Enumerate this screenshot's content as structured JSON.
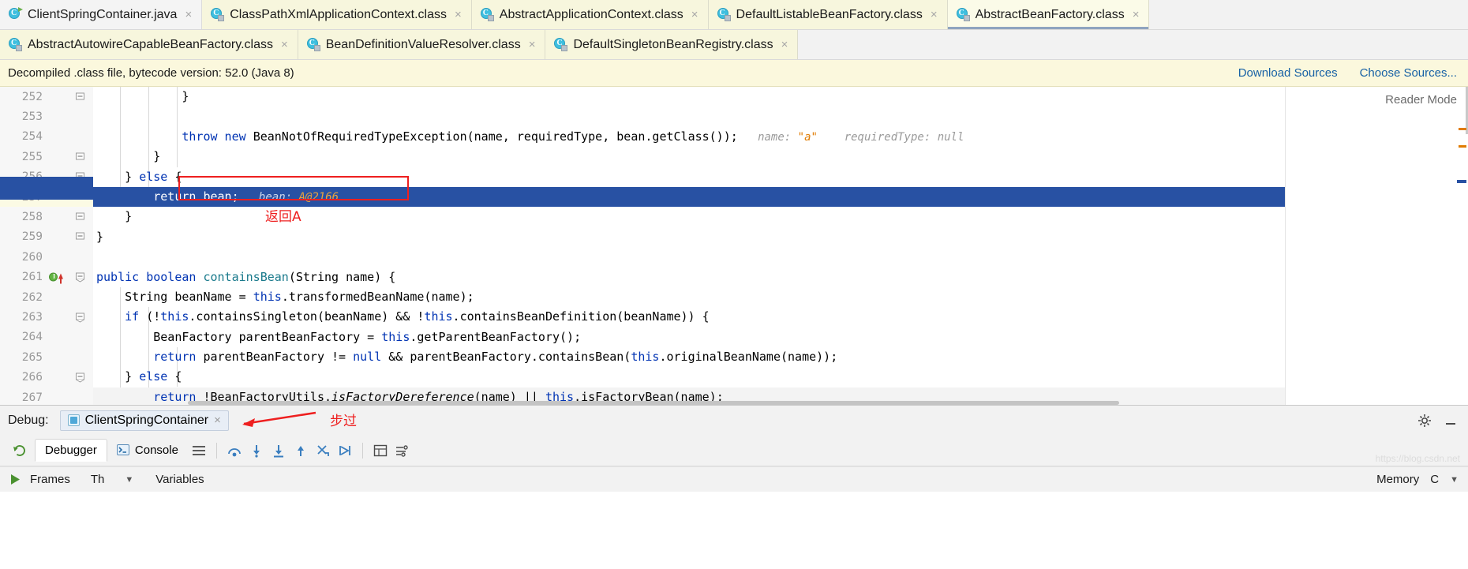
{
  "tabs_row1": [
    {
      "label": "ClientSpringContainer.java",
      "icon": "java-class-run-icon",
      "state": "inactive-white",
      "close": "×"
    },
    {
      "label": "ClassPathXmlApplicationContext.class",
      "icon": "class-file-icon",
      "state": "inactive",
      "close": "×"
    },
    {
      "label": "AbstractApplicationContext.class",
      "icon": "class-file-icon",
      "state": "inactive",
      "close": "×"
    },
    {
      "label": "DefaultListableBeanFactory.class",
      "icon": "class-file-icon",
      "state": "inactive",
      "close": "×"
    },
    {
      "label": "AbstractBeanFactory.class",
      "icon": "class-file-icon",
      "state": "selected",
      "close": "×"
    }
  ],
  "tabs_row2": [
    {
      "label": "AbstractAutowireCapableBeanFactory.class",
      "icon": "class-file-icon",
      "state": "inactive",
      "close": "×"
    },
    {
      "label": "BeanDefinitionValueResolver.class",
      "icon": "class-file-icon",
      "state": "inactive",
      "close": "×"
    },
    {
      "label": "DefaultSingletonBeanRegistry.class",
      "icon": "class-file-icon",
      "state": "inactive",
      "close": "×"
    }
  ],
  "notification": {
    "message": "Decompiled .class file, bytecode version: 52.0 (Java 8)",
    "download_sources": "Download Sources",
    "choose_sources": "Choose Sources...",
    "bg_color": "#fbf8dd"
  },
  "editor": {
    "reader_mode": "Reader Mode",
    "selection_color": "#2851a3",
    "annotation_color": "#ee1f1f",
    "lines": [
      {
        "num": "252",
        "fold": "minus",
        "text": "            }",
        "hint": "",
        "selected": false
      },
      {
        "num": "253",
        "fold": "",
        "text": "",
        "hint": "",
        "selected": false
      },
      {
        "num": "254",
        "fold": "",
        "text": "            throw new BeanNotOfRequiredTypeException(name, requiredType, bean.getClass());",
        "hint": "name: \"a\"     requiredType: null",
        "selected": false
      },
      {
        "num": "255",
        "fold": "minus",
        "text": "        }",
        "hint": "",
        "selected": false
      },
      {
        "num": "256",
        "fold": "minus",
        "text": "    } else {",
        "hint": "",
        "selected": false
      },
      {
        "num": "257",
        "fold": "",
        "text": "        return bean;",
        "hint": "bean: A@2166",
        "selected": true
      },
      {
        "num": "258",
        "fold": "minus",
        "text": "    }",
        "hint": "",
        "selected": false
      },
      {
        "num": "259",
        "fold": "minus",
        "text": "}",
        "hint": "",
        "selected": false
      },
      {
        "num": "260",
        "fold": "",
        "text": "",
        "hint": "",
        "selected": false
      },
      {
        "num": "261",
        "fold": "plus",
        "breakpoint": true,
        "text": "public boolean containsBean(String name) {",
        "hint": "",
        "selected": false
      },
      {
        "num": "262",
        "fold": "",
        "text": "    String beanName = this.transformedBeanName(name);",
        "hint": "",
        "selected": false
      },
      {
        "num": "263",
        "fold": "plus",
        "text": "    if (!this.containsSingleton(beanName) && !this.containsBeanDefinition(beanName)) {",
        "hint": "",
        "selected": false
      },
      {
        "num": "264",
        "fold": "",
        "text": "        BeanFactory parentBeanFactory = this.getParentBeanFactory();",
        "hint": "",
        "selected": false
      },
      {
        "num": "265",
        "fold": "",
        "text": "        return parentBeanFactory != null && parentBeanFactory.containsBean(this.originalBeanName(name));",
        "hint": "",
        "selected": false
      },
      {
        "num": "266",
        "fold": "minus",
        "text": "    } else {",
        "hint": "",
        "selected": false
      },
      {
        "num": "267",
        "fold": "",
        "text": "        return !BeanFactoryUtils.isFactoryDereference(name) || this.isFactoryBean(name);",
        "hint": "",
        "selected": false
      }
    ],
    "annotation_cn": "返回A"
  },
  "debug": {
    "label": "Debug:",
    "session_tab": "ClientSpringContainer",
    "session_close": "×",
    "step_annotation": "步过",
    "settings_icon": "gear-icon",
    "minimize_icon": "minimize-icon",
    "tabs": [
      {
        "label": "Debugger",
        "icon": "",
        "active": true
      },
      {
        "label": "Console",
        "icon": "console-icon",
        "active": false
      }
    ],
    "toolbar_icons": [
      "layout-icon",
      "step-over-icon",
      "step-into-icon",
      "force-step-into-icon",
      "step-out-icon",
      "drop-frame-icon",
      "run-to-cursor-icon",
      "evaluate-icon",
      "settings-list-icon"
    ],
    "footer": {
      "frames": "Frames",
      "thread": "Th",
      "variables": "Variables",
      "memory": "Memory",
      "right_letter": "C"
    },
    "watermark": "https://blog.csdn.net"
  }
}
